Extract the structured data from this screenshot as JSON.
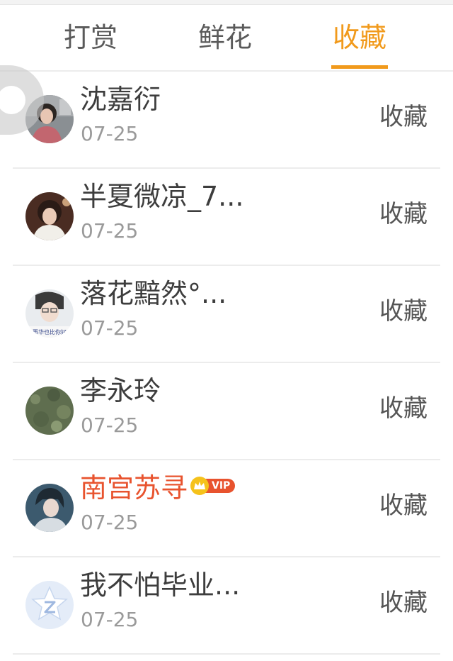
{
  "tabs": [
    {
      "label": "打赏",
      "active": false
    },
    {
      "label": "鲜花",
      "active": false
    },
    {
      "label": "收藏",
      "active": true
    }
  ],
  "accent_color": "#f19a1c",
  "vip_name_color": "#e8532e",
  "rows": [
    {
      "name": "沈嘉衍",
      "date": "07-25",
      "action": "收藏"
    },
    {
      "name": "半夏微凉_7...",
      "date": "07-25",
      "action": "收藏"
    },
    {
      "name": "落花黯然°...",
      "date": "07-25",
      "action": "收藏",
      "avatar_caption": "再华也比你好"
    },
    {
      "name": "李永玲",
      "date": "07-25",
      "action": "收藏"
    },
    {
      "name": "南宫苏寻",
      "date": "07-25",
      "action": "收藏",
      "vip": true,
      "vip_label": "VIP"
    },
    {
      "name": "我不怕毕业...",
      "date": "07-25",
      "action": "收藏"
    }
  ],
  "icons": [
    "floating-assistive-icon",
    "crown-icon",
    "star-z-icon"
  ]
}
